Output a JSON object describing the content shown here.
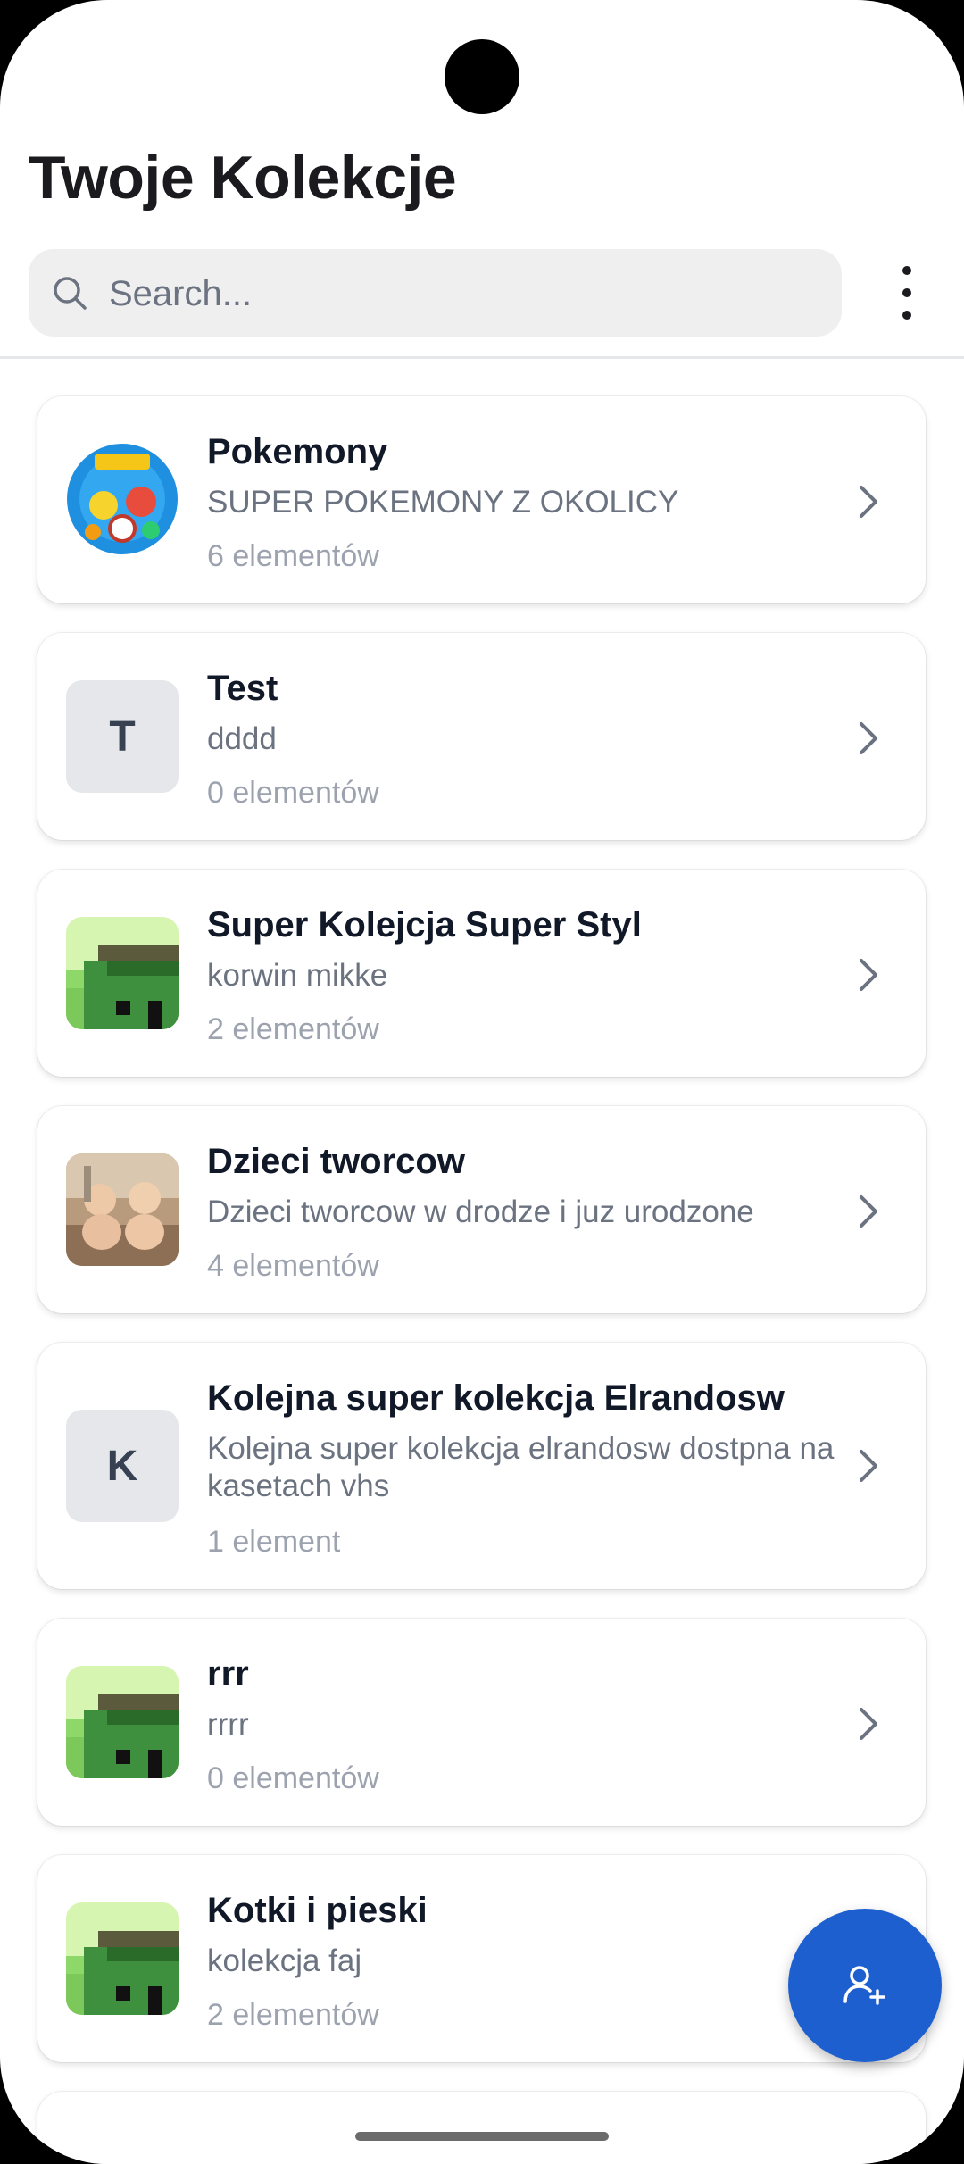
{
  "header": {
    "title": "Twoje Kolekcje"
  },
  "search": {
    "placeholder": "Search..."
  },
  "colors": {
    "accent": "#1e5fcf",
    "background": "#ffffff",
    "card_border": "#e5e7eb"
  },
  "collections": [
    {
      "name": "Pokemony",
      "description": "SUPER POKEMONY Z OKOLICY",
      "count": "6 elementów",
      "thumb": "pokemon-image"
    },
    {
      "name": "Test",
      "description": "dddd",
      "count": "0 elementów",
      "thumb_letter": "T"
    },
    {
      "name": "Super Kolejcja Super Styl",
      "description": "korwin mikke",
      "count": "2 elementów",
      "thumb": "pixel-art-image"
    },
    {
      "name": "Dzieci tworcow",
      "description": "Dzieci tworcow w drodze i juz urodzone",
      "count": "4 elementów",
      "thumb": "photo-image"
    },
    {
      "name": "Kolejna super kolekcja Elrandosw",
      "description": "Kolejna super kolekcja elrandosw dostpna na kasetach vhs",
      "count": "1 element",
      "thumb_letter": "K"
    },
    {
      "name": "rrr",
      "description": "rrrr",
      "count": "0 elementów",
      "thumb": "pixel-art-image"
    },
    {
      "name": "Kotki i pieski",
      "description": "kolekcja faj",
      "count": "2 elementów",
      "thumb": "pixel-art-image"
    }
  ],
  "fab": {
    "icon": "add-user-icon"
  }
}
